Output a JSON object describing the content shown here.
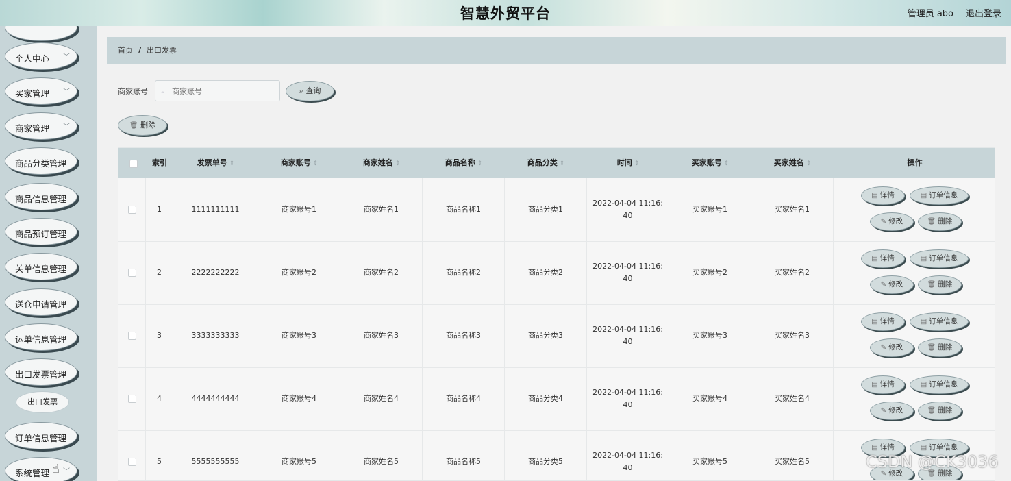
{
  "header": {
    "title": "智慧外贸平台",
    "user": "管理员 abo",
    "logout": "退出登录"
  },
  "sidebar": {
    "items": [
      {
        "label": "个人中心"
      },
      {
        "label": "买家管理"
      },
      {
        "label": "商家管理"
      },
      {
        "label": "商品分类管理"
      },
      {
        "label": "商品信息管理"
      },
      {
        "label": "商品预订管理"
      },
      {
        "label": "关单信息管理"
      },
      {
        "label": "送仓申请管理"
      },
      {
        "label": "运单信息管理"
      },
      {
        "label": "出口发票管理"
      },
      {
        "label": "订单信息管理"
      },
      {
        "label": "系统管理"
      }
    ],
    "active_sub": "出口发票"
  },
  "breadcrumb": {
    "home": "首页",
    "sep": "/",
    "current": "出口发票"
  },
  "search": {
    "label": "商家账号",
    "placeholder": "商家账号",
    "value": "",
    "query_label": "查询"
  },
  "toolbar": {
    "delete_label": "删除"
  },
  "table": {
    "columns": [
      "索引",
      "发票单号",
      "商家账号",
      "商家姓名",
      "商品名称",
      "商品分类",
      "时间",
      "买家账号",
      "买家姓名",
      "操作"
    ],
    "rows": [
      {
        "index": "1",
        "invoice": "1111111111",
        "merchant_account": "商家账号1",
        "merchant_name": "商家姓名1",
        "product_name": "商品名称1",
        "product_category": "商品分类1",
        "time": "2022-04-04 11:16:40",
        "buyer_account": "买家账号1",
        "buyer_name": "买家姓名1"
      },
      {
        "index": "2",
        "invoice": "2222222222",
        "merchant_account": "商家账号2",
        "merchant_name": "商家姓名2",
        "product_name": "商品名称2",
        "product_category": "商品分类2",
        "time": "2022-04-04 11:16:40",
        "buyer_account": "买家账号2",
        "buyer_name": "买家姓名2"
      },
      {
        "index": "3",
        "invoice": "3333333333",
        "merchant_account": "商家账号3",
        "merchant_name": "商家姓名3",
        "product_name": "商品名称3",
        "product_category": "商品分类3",
        "time": "2022-04-04 11:16:40",
        "buyer_account": "买家账号3",
        "buyer_name": "买家姓名3"
      },
      {
        "index": "4",
        "invoice": "4444444444",
        "merchant_account": "商家账号4",
        "merchant_name": "商家姓名4",
        "product_name": "商品名称4",
        "product_category": "商品分类4",
        "time": "2022-04-04 11:16:40",
        "buyer_account": "买家账号4",
        "buyer_name": "买家姓名4"
      },
      {
        "index": "5",
        "invoice": "5555555555",
        "merchant_account": "商家账号5",
        "merchant_name": "商家姓名5",
        "product_name": "商品名称5",
        "product_category": "商品分类5",
        "time": "2022-04-04 11:16:40",
        "buyer_account": "买家账号5",
        "buyer_name": "买家姓名5"
      }
    ],
    "actions": {
      "detail": "详情",
      "order_info": "订单信息",
      "edit": "修改",
      "delete": "删除"
    }
  },
  "icons": {
    "search": "search-icon",
    "delete": "trash-icon",
    "detail": "document-icon",
    "edit": "pencil-icon",
    "chevron": "chevron-down-icon"
  },
  "watermark": "CSDN @CK3036"
}
